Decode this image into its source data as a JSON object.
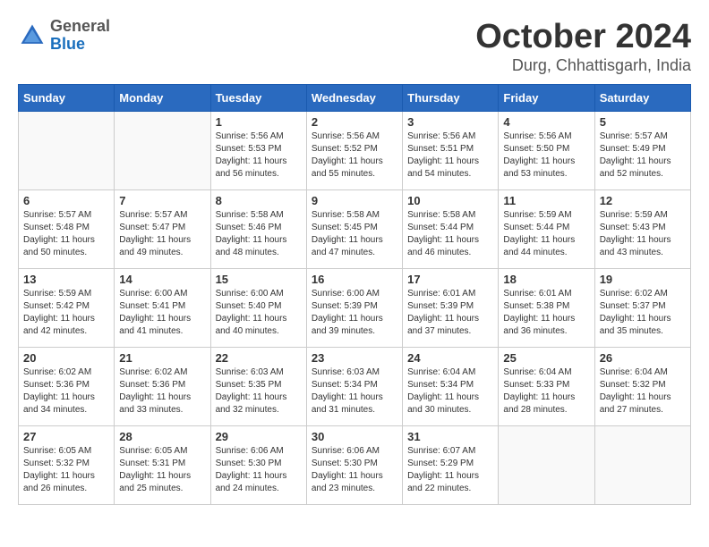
{
  "header": {
    "logo": {
      "general": "General",
      "blue": "Blue"
    },
    "title": "October 2024",
    "subtitle": "Durg, Chhattisgarh, India"
  },
  "days_of_week": [
    "Sunday",
    "Monday",
    "Tuesday",
    "Wednesday",
    "Thursday",
    "Friday",
    "Saturday"
  ],
  "weeks": [
    [
      {
        "day": "",
        "empty": true
      },
      {
        "day": "",
        "empty": true
      },
      {
        "day": "1",
        "sunrise": "Sunrise: 5:56 AM",
        "sunset": "Sunset: 5:53 PM",
        "daylight": "Daylight: 11 hours and 56 minutes."
      },
      {
        "day": "2",
        "sunrise": "Sunrise: 5:56 AM",
        "sunset": "Sunset: 5:52 PM",
        "daylight": "Daylight: 11 hours and 55 minutes."
      },
      {
        "day": "3",
        "sunrise": "Sunrise: 5:56 AM",
        "sunset": "Sunset: 5:51 PM",
        "daylight": "Daylight: 11 hours and 54 minutes."
      },
      {
        "day": "4",
        "sunrise": "Sunrise: 5:56 AM",
        "sunset": "Sunset: 5:50 PM",
        "daylight": "Daylight: 11 hours and 53 minutes."
      },
      {
        "day": "5",
        "sunrise": "Sunrise: 5:57 AM",
        "sunset": "Sunset: 5:49 PM",
        "daylight": "Daylight: 11 hours and 52 minutes."
      }
    ],
    [
      {
        "day": "6",
        "sunrise": "Sunrise: 5:57 AM",
        "sunset": "Sunset: 5:48 PM",
        "daylight": "Daylight: 11 hours and 50 minutes."
      },
      {
        "day": "7",
        "sunrise": "Sunrise: 5:57 AM",
        "sunset": "Sunset: 5:47 PM",
        "daylight": "Daylight: 11 hours and 49 minutes."
      },
      {
        "day": "8",
        "sunrise": "Sunrise: 5:58 AM",
        "sunset": "Sunset: 5:46 PM",
        "daylight": "Daylight: 11 hours and 48 minutes."
      },
      {
        "day": "9",
        "sunrise": "Sunrise: 5:58 AM",
        "sunset": "Sunset: 5:45 PM",
        "daylight": "Daylight: 11 hours and 47 minutes."
      },
      {
        "day": "10",
        "sunrise": "Sunrise: 5:58 AM",
        "sunset": "Sunset: 5:44 PM",
        "daylight": "Daylight: 11 hours and 46 minutes."
      },
      {
        "day": "11",
        "sunrise": "Sunrise: 5:59 AM",
        "sunset": "Sunset: 5:44 PM",
        "daylight": "Daylight: 11 hours and 44 minutes."
      },
      {
        "day": "12",
        "sunrise": "Sunrise: 5:59 AM",
        "sunset": "Sunset: 5:43 PM",
        "daylight": "Daylight: 11 hours and 43 minutes."
      }
    ],
    [
      {
        "day": "13",
        "sunrise": "Sunrise: 5:59 AM",
        "sunset": "Sunset: 5:42 PM",
        "daylight": "Daylight: 11 hours and 42 minutes."
      },
      {
        "day": "14",
        "sunrise": "Sunrise: 6:00 AM",
        "sunset": "Sunset: 5:41 PM",
        "daylight": "Daylight: 11 hours and 41 minutes."
      },
      {
        "day": "15",
        "sunrise": "Sunrise: 6:00 AM",
        "sunset": "Sunset: 5:40 PM",
        "daylight": "Daylight: 11 hours and 40 minutes."
      },
      {
        "day": "16",
        "sunrise": "Sunrise: 6:00 AM",
        "sunset": "Sunset: 5:39 PM",
        "daylight": "Daylight: 11 hours and 39 minutes."
      },
      {
        "day": "17",
        "sunrise": "Sunrise: 6:01 AM",
        "sunset": "Sunset: 5:39 PM",
        "daylight": "Daylight: 11 hours and 37 minutes."
      },
      {
        "day": "18",
        "sunrise": "Sunrise: 6:01 AM",
        "sunset": "Sunset: 5:38 PM",
        "daylight": "Daylight: 11 hours and 36 minutes."
      },
      {
        "day": "19",
        "sunrise": "Sunrise: 6:02 AM",
        "sunset": "Sunset: 5:37 PM",
        "daylight": "Daylight: 11 hours and 35 minutes."
      }
    ],
    [
      {
        "day": "20",
        "sunrise": "Sunrise: 6:02 AM",
        "sunset": "Sunset: 5:36 PM",
        "daylight": "Daylight: 11 hours and 34 minutes."
      },
      {
        "day": "21",
        "sunrise": "Sunrise: 6:02 AM",
        "sunset": "Sunset: 5:36 PM",
        "daylight": "Daylight: 11 hours and 33 minutes."
      },
      {
        "day": "22",
        "sunrise": "Sunrise: 6:03 AM",
        "sunset": "Sunset: 5:35 PM",
        "daylight": "Daylight: 11 hours and 32 minutes."
      },
      {
        "day": "23",
        "sunrise": "Sunrise: 6:03 AM",
        "sunset": "Sunset: 5:34 PM",
        "daylight": "Daylight: 11 hours and 31 minutes."
      },
      {
        "day": "24",
        "sunrise": "Sunrise: 6:04 AM",
        "sunset": "Sunset: 5:34 PM",
        "daylight": "Daylight: 11 hours and 30 minutes."
      },
      {
        "day": "25",
        "sunrise": "Sunrise: 6:04 AM",
        "sunset": "Sunset: 5:33 PM",
        "daylight": "Daylight: 11 hours and 28 minutes."
      },
      {
        "day": "26",
        "sunrise": "Sunrise: 6:04 AM",
        "sunset": "Sunset: 5:32 PM",
        "daylight": "Daylight: 11 hours and 27 minutes."
      }
    ],
    [
      {
        "day": "27",
        "sunrise": "Sunrise: 6:05 AM",
        "sunset": "Sunset: 5:32 PM",
        "daylight": "Daylight: 11 hours and 26 minutes."
      },
      {
        "day": "28",
        "sunrise": "Sunrise: 6:05 AM",
        "sunset": "Sunset: 5:31 PM",
        "daylight": "Daylight: 11 hours and 25 minutes."
      },
      {
        "day": "29",
        "sunrise": "Sunrise: 6:06 AM",
        "sunset": "Sunset: 5:30 PM",
        "daylight": "Daylight: 11 hours and 24 minutes."
      },
      {
        "day": "30",
        "sunrise": "Sunrise: 6:06 AM",
        "sunset": "Sunset: 5:30 PM",
        "daylight": "Daylight: 11 hours and 23 minutes."
      },
      {
        "day": "31",
        "sunrise": "Sunrise: 6:07 AM",
        "sunset": "Sunset: 5:29 PM",
        "daylight": "Daylight: 11 hours and 22 minutes."
      },
      {
        "day": "",
        "empty": true
      },
      {
        "day": "",
        "empty": true
      }
    ]
  ]
}
